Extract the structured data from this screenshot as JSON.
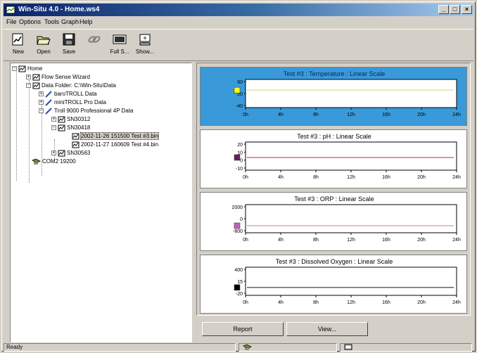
{
  "window": {
    "title": "Win-Situ 4.0 - Home.ws4",
    "minimize": "_",
    "maximize": "□",
    "close": "×"
  },
  "menu": [
    "File",
    "Options",
    "Tools",
    "Graph",
    "Help"
  ],
  "toolbar": [
    {
      "label": "New",
      "icon": "new-icon"
    },
    {
      "label": "Open",
      "icon": "open-icon"
    },
    {
      "label": "Save",
      "icon": "save-icon"
    },
    {
      "label": "",
      "icon": "link-icon"
    },
    {
      "label": "Full S...",
      "icon": "fullscreen-icon"
    },
    {
      "label": "Show...",
      "icon": "show-icon"
    }
  ],
  "tree": {
    "home": "Home",
    "flow_wizard": "Flow Sense Wizard",
    "data_folder": "Data Folder: C:\\Win-Situ\\Data",
    "baro": "baroTROLL Data",
    "mini": "miniTROLL Pro Data",
    "troll9000": "Troll 9000 Professional 4P Data",
    "sn1": "SN30312",
    "sn2": "SN30418",
    "file1": "2002-11-26 151500 Test #3.bin",
    "file2": "2002-11-27 160609 Test #4.bin",
    "sn3": "SN30563",
    "com": "COM2 19200"
  },
  "charts": [
    {
      "title": "Test #3 : Temperature : Linear Scale",
      "y_ticks": [
        "60",
        "20",
        "-40"
      ],
      "x_ticks": [
        "0h",
        "4h",
        "8h",
        "12h",
        "16h",
        "20h",
        "24h"
      ],
      "level": 0.38,
      "line_color": "#d8d890",
      "marker_color": "#ffff00",
      "active": true
    },
    {
      "title": "Test #3 : pH : Linear Scale",
      "y_ticks": [
        "20",
        "10",
        "0",
        "-10"
      ],
      "x_ticks": [
        "0h",
        "4h",
        "8h",
        "12h",
        "16h",
        "20h",
        "24h"
      ],
      "level": 0.55,
      "line_color": "#c05070",
      "marker_color": "#602060",
      "active": false
    },
    {
      "title": "Test #3 : ORP : Linear Scale",
      "y_ticks": [
        "2000",
        "0",
        "-800"
      ],
      "x_ticks": [
        "0h",
        "4h",
        "8h",
        "12h",
        "16h",
        "20h",
        "24h"
      ],
      "level": 0.75,
      "line_color": "#e090c0",
      "marker_color": "#c060c0",
      "active": false
    },
    {
      "title": "Test #3 : Dissolved Oxygen : Linear Scale",
      "y_ticks": [
        "400",
        "15",
        "-20"
      ],
      "x_ticks": [
        "0h",
        "4h",
        "8h",
        "12h",
        "16h",
        "20h",
        "24h"
      ],
      "level": 0.72,
      "line_color": "#303030",
      "marker_color": "#000000",
      "active": false
    }
  ],
  "buttons": {
    "report": "Report",
    "view": "View..."
  },
  "status": {
    "text": "Ready"
  }
}
